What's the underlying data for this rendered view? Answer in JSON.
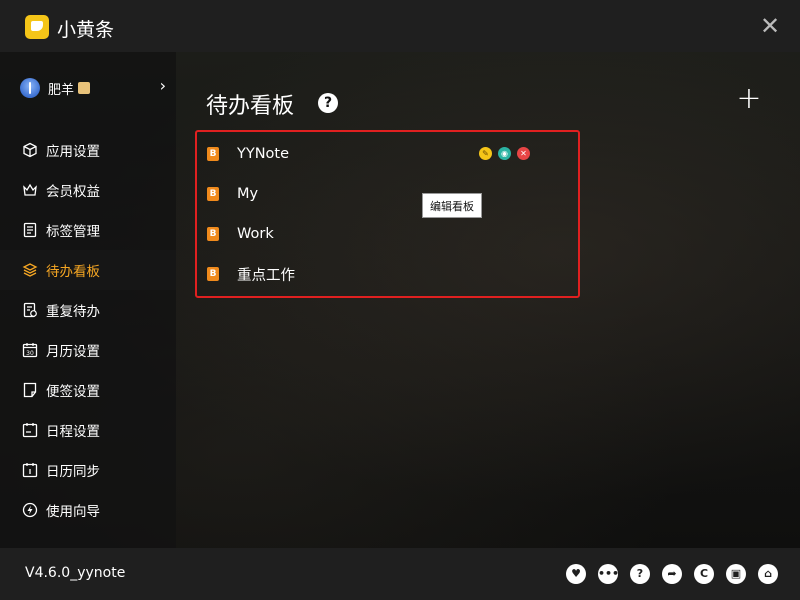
{
  "app": {
    "title": "小黄条",
    "close_symbol": "✕"
  },
  "user": {
    "name": "肥羊",
    "chevron": "›"
  },
  "nav": [
    {
      "label": "应用设置",
      "icon": "cube-icon"
    },
    {
      "label": "会员权益",
      "icon": "crown-icon"
    },
    {
      "label": "标签管理",
      "icon": "list-icon"
    },
    {
      "label": "待办看板",
      "icon": "layers-icon",
      "active": true
    },
    {
      "label": "重复待办",
      "icon": "repeat-icon"
    },
    {
      "label": "月历设置",
      "icon": "calendar-30-icon"
    },
    {
      "label": "便签设置",
      "icon": "note-icon"
    },
    {
      "label": "日程设置",
      "icon": "schedule-icon"
    },
    {
      "label": "日历同步",
      "icon": "sync-calendar-icon"
    },
    {
      "label": "使用向导",
      "icon": "compass-icon"
    }
  ],
  "page": {
    "title": "待办看板",
    "help_symbol": "?",
    "add_symbol": "+"
  },
  "boards": [
    {
      "badge": "B",
      "name": "YYNote"
    },
    {
      "badge": "B",
      "name": "My"
    },
    {
      "badge": "B",
      "name": "Work"
    },
    {
      "badge": "B",
      "name": "重点工作"
    }
  ],
  "tooltip": {
    "text": "编辑看板"
  },
  "footer": {
    "version": "V4.6.0_yynote",
    "icons": [
      "heart-icon",
      "chat-icon",
      "help-icon",
      "share-icon",
      "refresh-icon",
      "office-icon",
      "home-icon"
    ]
  },
  "colors": {
    "accent": "#f5a623",
    "highlight_border": "#e02020",
    "board_badge": "#f08a1c",
    "action_edit": "#f5c518",
    "action_view": "#2bb3a3",
    "action_delete": "#e84545"
  }
}
